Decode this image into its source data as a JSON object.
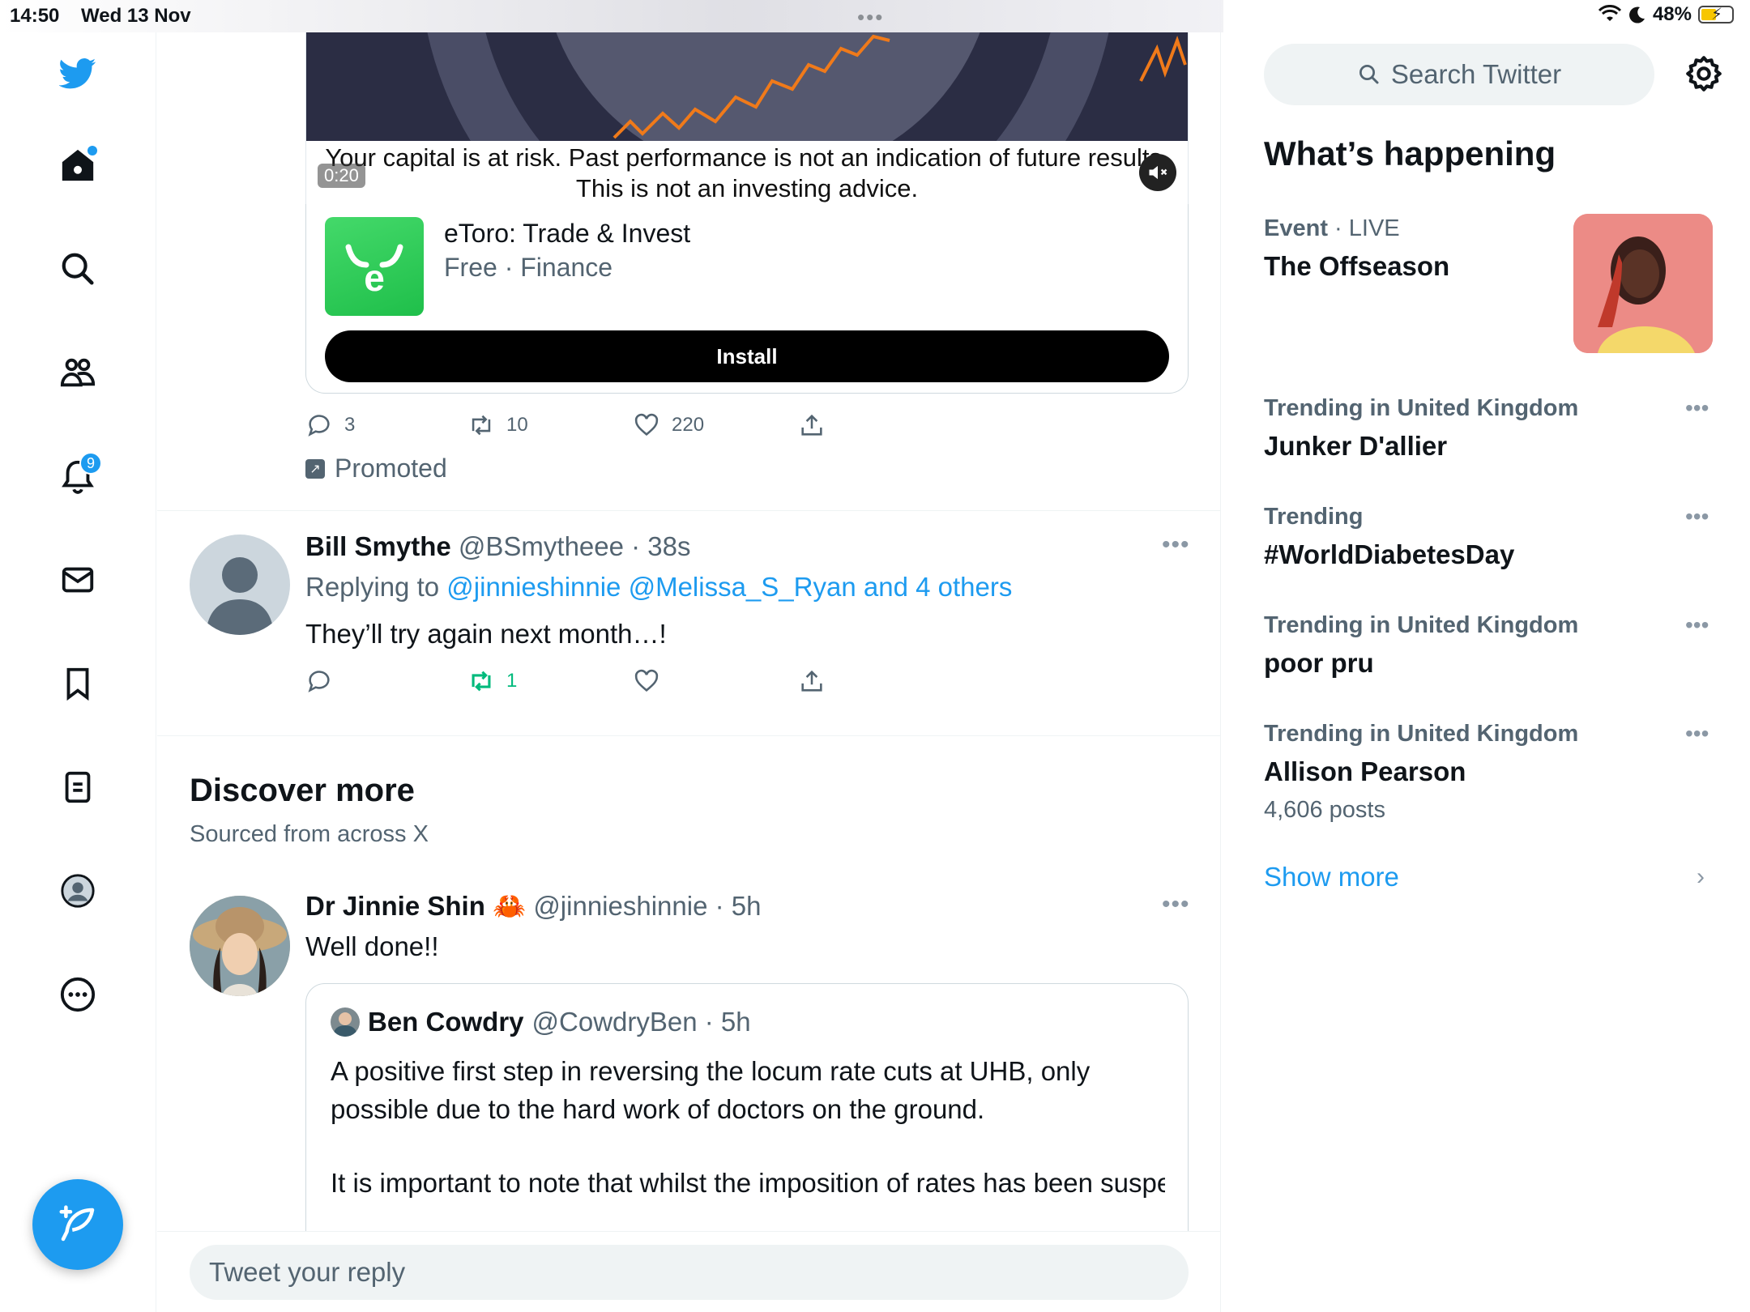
{
  "status_bar": {
    "time": "14:50",
    "date": "Wed 13 Nov",
    "battery": "48%"
  },
  "nav": {
    "notifications_count": "9"
  },
  "promoted_tweet": {
    "video_caption": "Your capital is at risk. Past performance is not an indication of future results. This is not an investing advice.",
    "video_timer": "0:20",
    "app_name": "eToro: Trade & Invest",
    "app_meta": "Free · Finance",
    "install_label": "Install",
    "replies": "3",
    "retweets": "10",
    "likes": "220",
    "promoted_label": "Promoted"
  },
  "reply_tweet": {
    "name": "Bill Smythe",
    "handle_time": "@BSmytheee · 38s",
    "replying_prefix": "Replying to",
    "replying_to": "@jinnieshinnie @Melissa_S_Ryan and 4 others",
    "text": "They’ll try again next month…!",
    "retweets": "1"
  },
  "discover": {
    "title": "Discover more",
    "subtitle": "Sourced from across X"
  },
  "discover_tweet": {
    "name": "Dr Jinnie Shin",
    "emoji": "🦀",
    "handle_time": "@jinnieshinnie · 5h",
    "text": "Well done!!",
    "quote": {
      "name": "Ben Cowdry",
      "handle_time": "@CowdryBen · 5h",
      "para1": "A positive first step in reversing the locum rate cuts at UHB, only possible due to the hard work of doctors on the ground.",
      "para2": "It is important to note that whilst the imposition of rates has been suspended, doctors must be prepared to oppose any future rate c..."
    }
  },
  "reply_bar": {
    "placeholder": "Tweet your reply"
  },
  "sidebar": {
    "search_placeholder": "Search Twitter",
    "whats_happening": "What’s happening",
    "event": {
      "category": "Event",
      "status": "LIVE",
      "title": "The Offseason"
    },
    "trends": [
      {
        "meta": "Trending in United Kingdom",
        "name": "Junker D'allier",
        "count": ""
      },
      {
        "meta": "Trending",
        "name": "#WorldDiabetesDay",
        "count": ""
      },
      {
        "meta": "Trending in United Kingdom",
        "name": "poor pru",
        "count": ""
      },
      {
        "meta": "Trending in United Kingdom",
        "name": "Allison Pearson",
        "count": "4,606 posts"
      }
    ],
    "show_more": "Show more"
  },
  "colors": {
    "accent": "#1d9bf0",
    "retweet_green": "#00ba7c",
    "etoro_green": "#2fcb55"
  }
}
